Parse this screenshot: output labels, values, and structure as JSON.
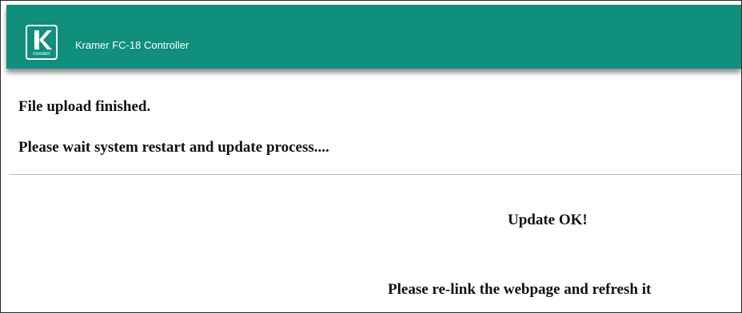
{
  "header": {
    "app_title": "Kramer FC-18 Controller",
    "logo_icon": "kramer-logo-icon",
    "logo_text": "KRAMER",
    "bar_color": "#0f8f7c"
  },
  "messages": {
    "upload_finished": "File upload finished.",
    "wait_restart": "Please wait system restart and update process...."
  },
  "status": {
    "result": "Update OK!",
    "instruction": "Please re-link the webpage and refresh it"
  }
}
